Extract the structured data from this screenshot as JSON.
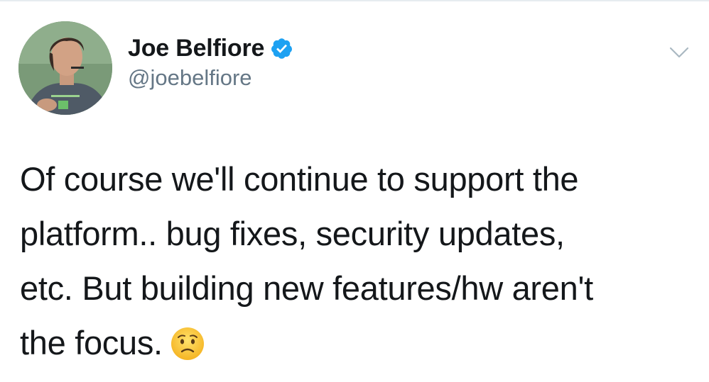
{
  "author": {
    "display_name": "Joe Belfiore",
    "handle": "@joebelfiore",
    "verified": true,
    "avatar_icon": "profile-photo",
    "verified_icon": "verified-badge-icon"
  },
  "tweet": {
    "lines": [
      "Of course we'll continue to support the",
      "platform.. bug fixes, security updates,",
      "etc. But building new features/hw aren't",
      "the focus."
    ],
    "emoji": "worried-face-emoji"
  },
  "menu": {
    "icon": "chevron-down-icon"
  },
  "colors": {
    "text": "#14171a",
    "secondary": "#657786",
    "verified": "#1da1f2",
    "caret": "#aab8c2"
  }
}
